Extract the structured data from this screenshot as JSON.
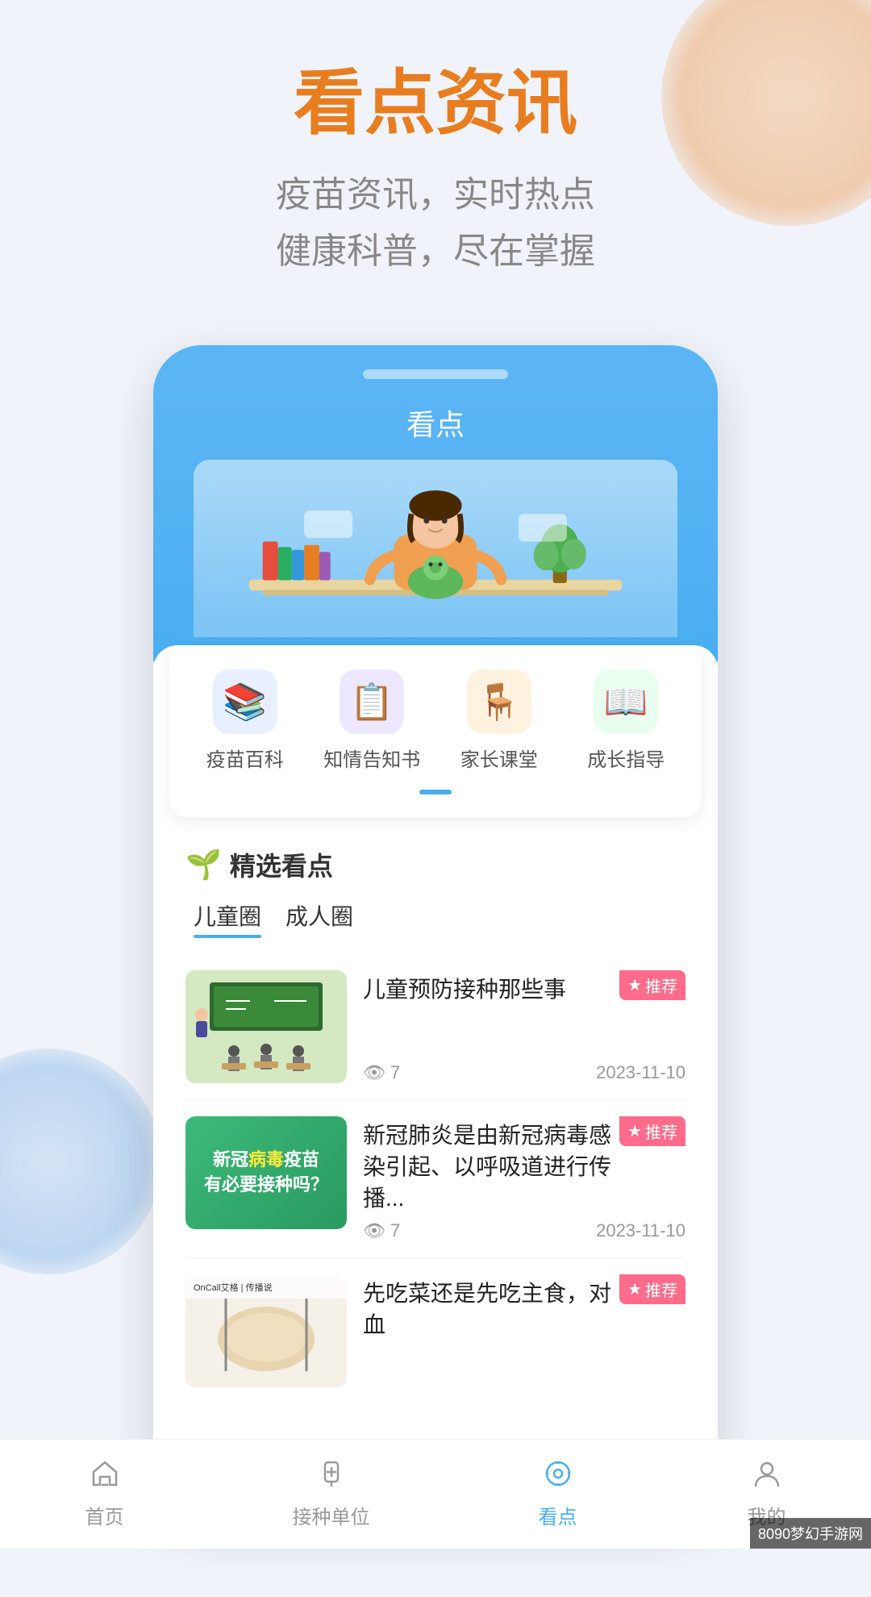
{
  "page": {
    "title": "看点资讯",
    "subtitle_line1": "疫苗资讯，实时热点",
    "subtitle_line2": "健康科普，尽在掌握"
  },
  "phone": {
    "title": "看点"
  },
  "categories": [
    {
      "id": "vaccine-wiki",
      "label": "疫苗百科",
      "emoji": "📚",
      "color": "#e8f0ff"
    },
    {
      "id": "informed-consent",
      "label": "知情告知书",
      "emoji": "📋",
      "color": "#ede8ff"
    },
    {
      "id": "parent-class",
      "label": "家长课堂",
      "emoji": "🪑",
      "color": "#fff3e0"
    },
    {
      "id": "growth-guide",
      "label": "成长指导",
      "emoji": "📖",
      "color": "#e8fff0"
    }
  ],
  "selected_section": {
    "title": "精选看点",
    "icon": "🌱"
  },
  "tabs": [
    {
      "id": "children",
      "label": "儿童圈",
      "active": true
    },
    {
      "id": "adults",
      "label": "成人圈",
      "active": false
    }
  ],
  "news_items": [
    {
      "id": "news-1",
      "title": "儿童预防接种那些事",
      "views": "7",
      "date": "2023-11-10",
      "badge": "推荐",
      "thumb_type": "classroom"
    },
    {
      "id": "news-2",
      "title": "新冠肺炎是由新冠病毒感染引起、以呼吸道进行传播...",
      "views": "7",
      "date": "2023-11-10",
      "badge": "推荐",
      "thumb_type": "vaccine-banner"
    },
    {
      "id": "news-3",
      "title": "先吃菜还是先吃主食，对血",
      "views": "",
      "date": "",
      "badge": "推荐",
      "thumb_type": "food"
    }
  ],
  "nav": {
    "items": [
      {
        "id": "home",
        "label": "首页",
        "active": false
      },
      {
        "id": "vaccination-sites",
        "label": "接种单位",
        "active": false
      },
      {
        "id": "news",
        "label": "看点",
        "active": true
      },
      {
        "id": "mine",
        "label": "我的",
        "active": false
      }
    ]
  },
  "watermark": "8090梦幻手游网"
}
